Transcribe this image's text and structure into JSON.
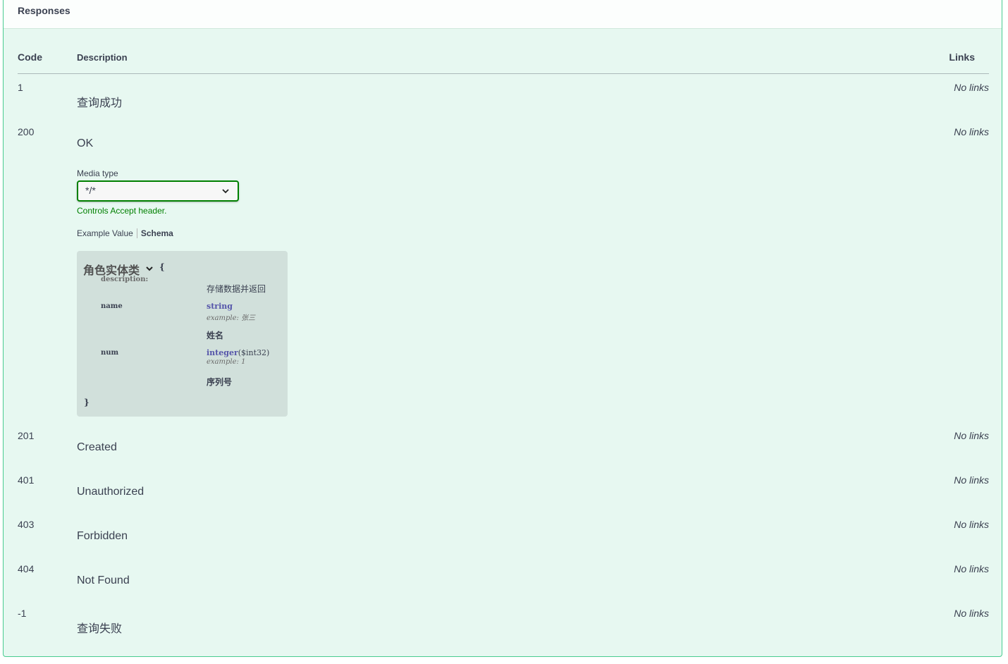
{
  "section": {
    "title": "Responses"
  },
  "table": {
    "headers": {
      "code": "Code",
      "description": "Description",
      "links": "Links"
    }
  },
  "responses": [
    {
      "code": "1",
      "description": "查询成功",
      "links": "No links"
    },
    {
      "code": "200",
      "description": "OK",
      "links": "No links"
    },
    {
      "code": "201",
      "description": "Created",
      "links": "No links"
    },
    {
      "code": "401",
      "description": "Unauthorized",
      "links": "No links"
    },
    {
      "code": "403",
      "description": "Forbidden",
      "links": "No links"
    },
    {
      "code": "404",
      "description": "Not Found",
      "links": "No links"
    },
    {
      "code": "-1",
      "description": "查询失败",
      "links": "No links"
    }
  ],
  "media": {
    "label": "Media type",
    "selected": "*/*",
    "hint": "Controls Accept header."
  },
  "tabs": {
    "example": "Example Value",
    "schema": "Schema",
    "active": "schema"
  },
  "schema": {
    "title": "角色实体类",
    "open_brace": "{",
    "close_brace": "}",
    "description_key": "description:",
    "description_value": "存储数据并返回",
    "properties": [
      {
        "name": "name",
        "type": "string",
        "format": "",
        "example_label": "example:",
        "example": "张三",
        "description": "姓名"
      },
      {
        "name": "num",
        "type": "integer",
        "format": "($int32)",
        "example_label": "example:",
        "example": "1",
        "description": "序列号"
      }
    ]
  },
  "colors": {
    "accent": "#49cc90",
    "select_border": "#008000",
    "hint": "#008000",
    "type_kw": "#5555aa"
  },
  "icons": {
    "select": "chevron-down-icon",
    "model_toggle": "chevron-down-icon"
  }
}
